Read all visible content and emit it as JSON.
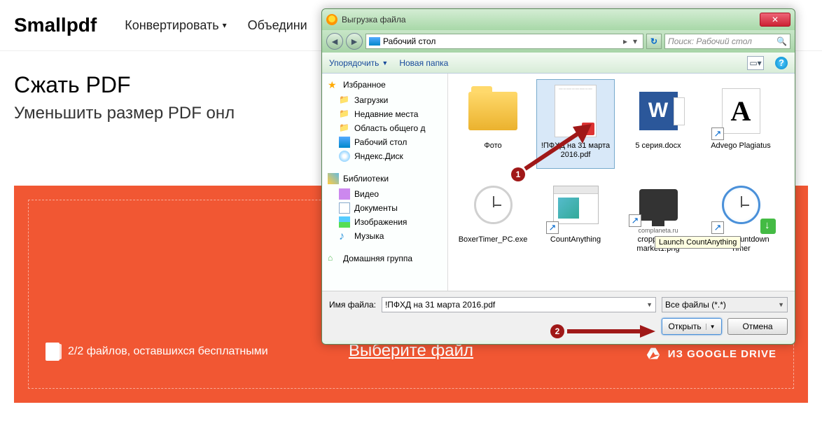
{
  "site": {
    "logo": "Smallpdf",
    "nav": {
      "convert": "Конвертировать",
      "merge": "Объедини"
    },
    "page_title": "Сжать PDF",
    "page_subtitle": "Уменьшить размер PDF онл",
    "free_left": "2/2 файлов, оставшихся бесплатными",
    "choose_file": "Выберите файл",
    "gdrive": "ИЗ GOOGLE DRIVE"
  },
  "dialog": {
    "title": "Выгрузка файла",
    "breadcrumb": "Рабочий стол",
    "search_placeholder": "Поиск: Рабочий стол",
    "toolbar": {
      "organize": "Упорядочить",
      "new_folder": "Новая папка"
    },
    "sidebar": {
      "favorites": "Избранное",
      "fav_items": [
        "Загрузки",
        "Недавние места",
        "Область общего д",
        "Рабочий стол",
        "Яндекс.Диск"
      ],
      "libraries": "Библиотеки",
      "lib_items": [
        "Видео",
        "Документы",
        "Изображения",
        "Музыка"
      ],
      "homegroup": "Домашняя группа"
    },
    "files": [
      {
        "name": "Фото",
        "type": "folder"
      },
      {
        "name": "!ПФХД на 31 марта 2016.pdf",
        "type": "pdf",
        "selected": true
      },
      {
        "name": "5 серия.docx",
        "type": "word"
      },
      {
        "name": "Advego Plagiatus",
        "type": "letter"
      },
      {
        "name": "BoxerTimer_PC.exe",
        "type": "clock"
      },
      {
        "name": "CountAnything",
        "type": "appwin"
      },
      {
        "name": "cropped-pc-market1.png",
        "type": "image"
      },
      {
        "name": "Free Countdown Timer",
        "type": "clock-blue"
      }
    ],
    "complaneta": "complaneta.ru",
    "tooltip": "Launch CountAnything",
    "filename_label": "Имя файла:",
    "filename_value": "!ПФХД на 31 марта 2016.pdf",
    "filter": "Все файлы (*.*)",
    "open": "Открыть",
    "cancel": "Отмена"
  },
  "anno": {
    "one": "1",
    "two": "2"
  }
}
